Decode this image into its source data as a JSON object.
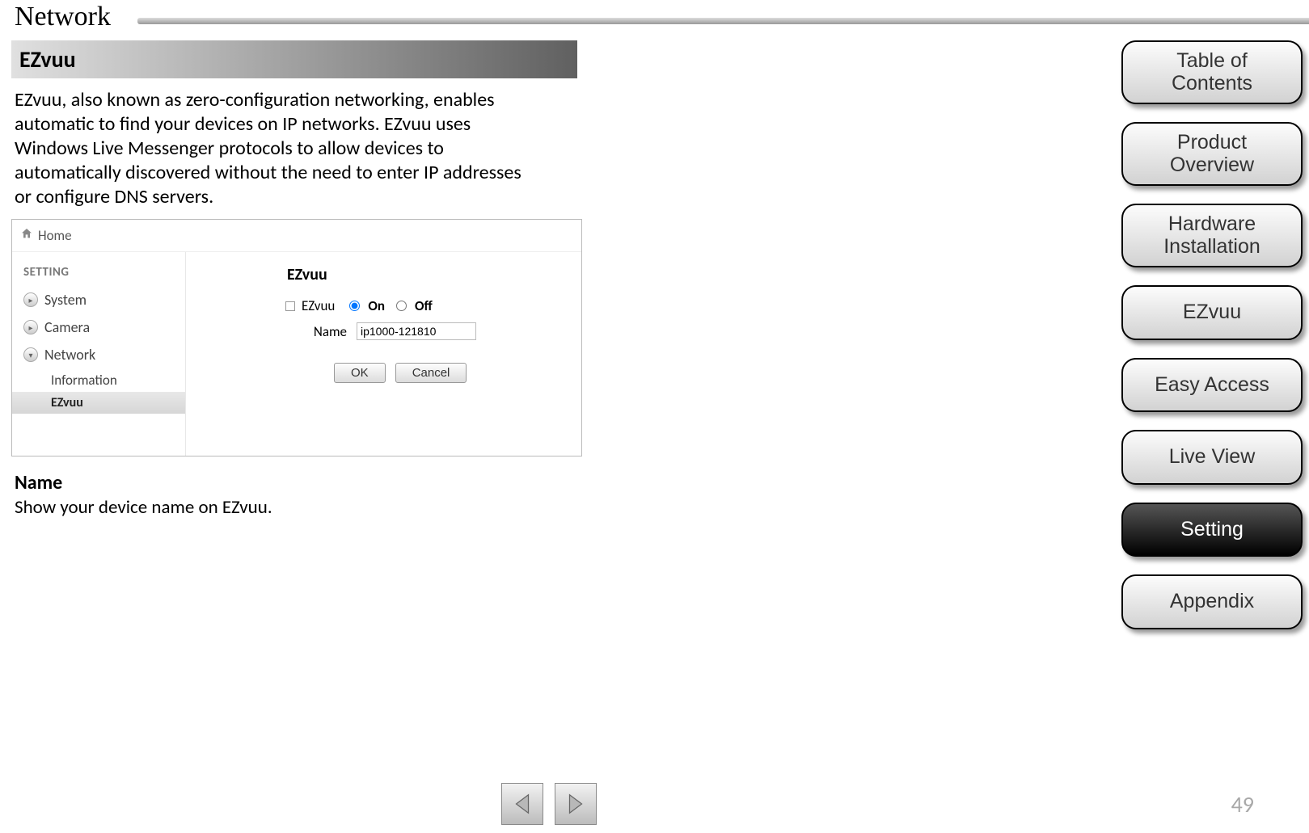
{
  "page": {
    "title": "Network",
    "number": "49"
  },
  "section": {
    "header": "EZvuu",
    "description": "EZvuu, also known as zero-configuration networking, enables automatic to find your devices on IP networks. EZvuu uses Windows Live Messenger protocols to allow devices to automatically discovered without the need to enter IP addresses or configure DNS servers."
  },
  "screenshot": {
    "home": "Home",
    "setting_label": "SETTING",
    "items": {
      "system": "System",
      "camera": "Camera",
      "network": "Network",
      "information": "Information",
      "ezvuu": "EZvuu"
    },
    "main_title": "EZvuu",
    "ezvuu_label": "EZvuu",
    "on_label": "On",
    "off_label": "Off",
    "name_label": "Name",
    "name_value": "ip1000-121810",
    "ok": "OK",
    "cancel": "Cancel"
  },
  "name_section": {
    "heading": "Name",
    "desc": "Show  your device name on EZvuu."
  },
  "nav": {
    "toc": "Table of\nContents",
    "product": "Product\nOverview",
    "hardware": "Hardware\nInstallation",
    "ezvuu": "EZvuu",
    "easy": "Easy Access",
    "live": "Live View",
    "setting": "Setting",
    "appendix": "Appendix"
  }
}
